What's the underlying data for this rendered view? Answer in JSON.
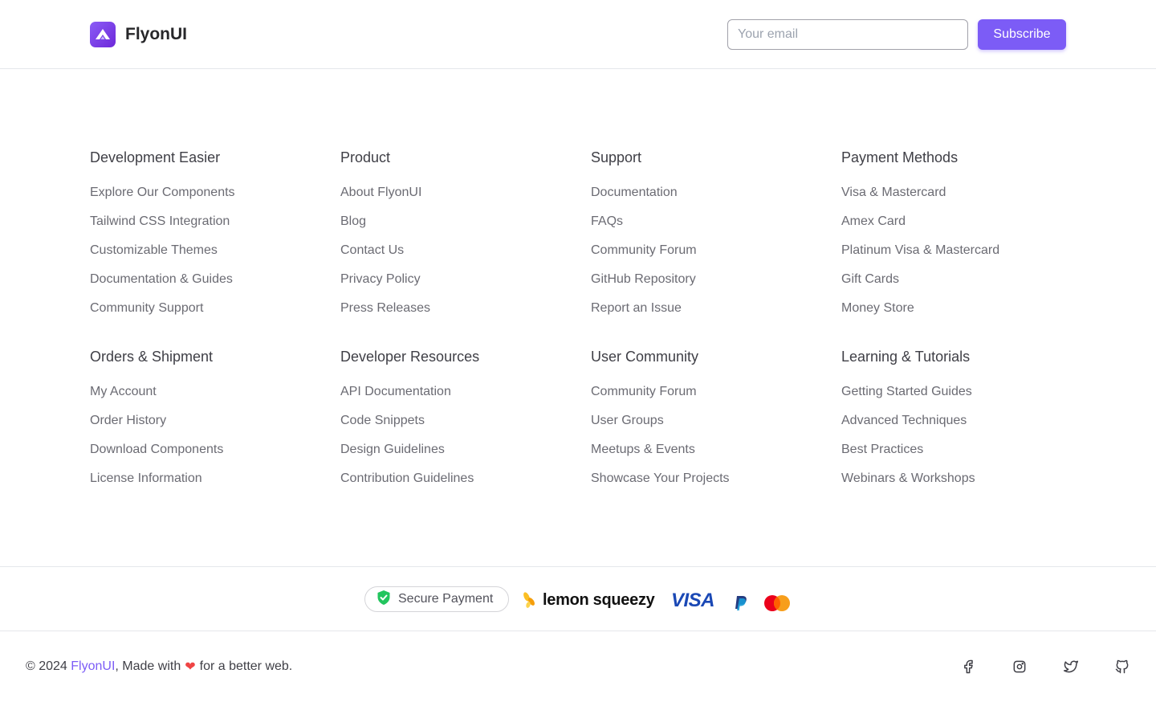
{
  "header": {
    "brand_name": "FlyonUI",
    "email_placeholder": "Your email",
    "subscribe_label": "Subscribe",
    "accent_color": "#7c5cf6"
  },
  "columns": [
    {
      "title": "Development Easier",
      "links": [
        "Explore Our Components",
        "Tailwind CSS Integration",
        "Customizable Themes",
        "Documentation & Guides",
        "Community Support"
      ]
    },
    {
      "title": "Product",
      "links": [
        "About FlyonUI",
        "Blog",
        "Contact Us",
        "Privacy Policy",
        "Press Releases"
      ]
    },
    {
      "title": "Support",
      "links": [
        "Documentation",
        "FAQs",
        "Community Forum",
        "GitHub Repository",
        "Report an Issue"
      ]
    },
    {
      "title": "Payment Methods",
      "links": [
        "Visa & Mastercard",
        "Amex Card",
        "Platinum Visa & Mastercard",
        "Gift Cards",
        "Money Store"
      ]
    },
    {
      "title": "Orders & Shipment",
      "links": [
        "My Account",
        "Order History",
        "Download Components",
        "License Information"
      ]
    },
    {
      "title": "Developer Resources",
      "links": [
        "API Documentation",
        "Code Snippets",
        "Design Guidelines",
        "Contribution Guidelines"
      ]
    },
    {
      "title": "User Community",
      "links": [
        "Community Forum",
        "User Groups",
        "Meetups & Events",
        "Showcase Your Projects"
      ]
    },
    {
      "title": "Learning & Tutorials",
      "links": [
        "Getting Started Guides",
        "Advanced Techniques",
        "Best Practices",
        "Webinars & Workshops"
      ]
    }
  ],
  "payment": {
    "secure_label": "Secure Payment",
    "lemon_label": "lemon squeezy",
    "visa_label": "VISA",
    "icons": [
      "shield-check-icon",
      "lemon-squeezy-logo",
      "visa-logo",
      "paypal-logo",
      "mastercard-logo"
    ]
  },
  "footer": {
    "copyright_prefix": "© 2024 ",
    "brand_link": "FlyonUI",
    "made_with": ", Made with",
    "heart": "❤",
    "suffix": "for a better web.",
    "social_icons": [
      "facebook-icon",
      "instagram-icon",
      "twitter-icon",
      "github-icon"
    ]
  }
}
